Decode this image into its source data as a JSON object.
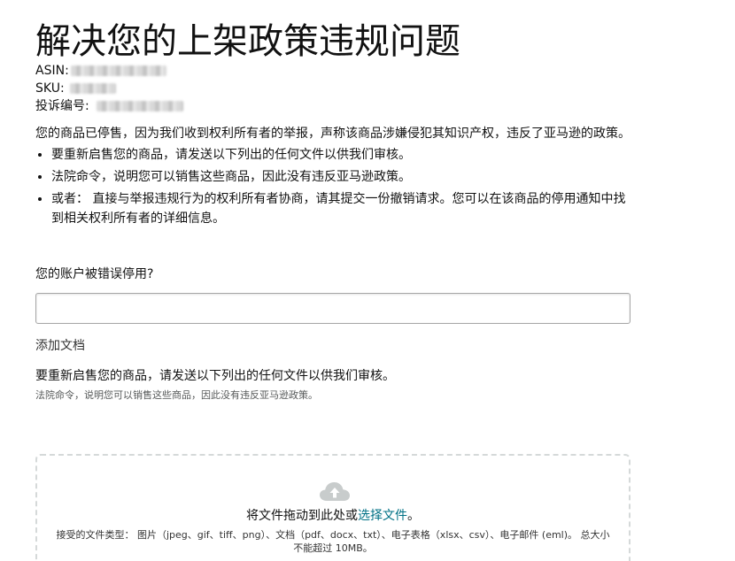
{
  "page": {
    "title": "解决您的上架政策违规问题"
  },
  "meta": {
    "asin_label": "ASIN:",
    "sku_label": "SKU:",
    "complaint_label": "投诉编号:"
  },
  "intro": {
    "text": "您的商品已停售，因为我们收到权利所有者的举报，声称该商品涉嫌侵犯其知识产权，违反了亚马逊的政策。",
    "bullets": [
      "要重新启售您的商品，请发送以下列出的任何文件以供我们审核。",
      "法院命令，说明您可以销售这些商品，因此没有违反亚马逊政策。",
      "或者：  直接与举报违规行为的权利所有者协商，请其提交一份撤销请求。您可以在该商品的停用通知中找到相关权利所有者的详细信息。"
    ]
  },
  "form": {
    "question_label": "您的账户被错误停用?",
    "input_value": ""
  },
  "documents": {
    "section_label": "添加文档",
    "heading": "要重新启售您的商品，请发送以下列出的任何文件以供我们审核。",
    "note": "法院命令，说明您可以销售这些商品，因此没有违反亚马逊政策。",
    "dropzone": {
      "icon": "cloud-upload-icon",
      "text_before": "将文件拖动到此处或",
      "link_text": "选择文件",
      "text_after": "。",
      "accepted": "接受的文件类型：  图片（jpeg、gif、tiff、png）、文档（pdf、docx、txt）、电子表格（xlsx、csv）、电子邮件 (eml)。 总大小不能超过 10MB。"
    }
  },
  "colors": {
    "link": "#007185",
    "text": "#0f1111",
    "dashed_border": "#d5d9d9"
  }
}
